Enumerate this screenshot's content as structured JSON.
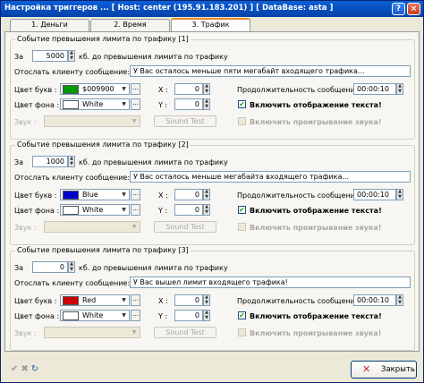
{
  "window": {
    "title": "Настройка триггеров ... [ Host: center (195.91.183.201) ] [ DataBase: asta ]",
    "help": "?",
    "close": "×"
  },
  "tabs": [
    {
      "label": "1. Деньги"
    },
    {
      "label": "2. Время"
    },
    {
      "label": "3. Трафик"
    }
  ],
  "labels": {
    "za": "За",
    "kb_suffix": "кб. до превышения лимита по трафику",
    "message": "Отослать клиенту сообщение:",
    "text_color": "Цвет букв :",
    "bg_color": "Цвет фона :",
    "sound": "Звук :",
    "x": "X :",
    "y": "Y :",
    "duration": "Продолжительность сообщения :",
    "sound_test": "Sound Test",
    "show_text": "Включить отображение текста!",
    "play_sound": "Включить проигрывание звука!",
    "dots": "…"
  },
  "groups": [
    {
      "legend": "Событие превышения лимита по трафику [1]",
      "kb": "5000",
      "message": "У Вас осталось меньше пяти мегабайт входящего трафика...",
      "text_color": {
        "name": "$009900",
        "hex": "#009900"
      },
      "bg_color": {
        "name": "White",
        "hex": "#ffffff"
      },
      "x": "0",
      "y": "0",
      "duration": "00:00:10",
      "show_text": true,
      "play_sound": false
    },
    {
      "legend": "Событие превышения лимита по трафику [2]",
      "kb": "1000",
      "message": "У Вас осталось меньше мегабайта входящего трафика...",
      "text_color": {
        "name": "Blue",
        "hex": "#0000cc"
      },
      "bg_color": {
        "name": "White",
        "hex": "#ffffff"
      },
      "x": "0",
      "y": "0",
      "duration": "00:00:10",
      "show_text": true,
      "play_sound": false
    },
    {
      "legend": "Событие превышения лимита по трафику [3]",
      "kb": "0",
      "message": "У Вас вышел лимит входящего трафика!",
      "text_color": {
        "name": "Red",
        "hex": "#cc0000"
      },
      "bg_color": {
        "name": "White",
        "hex": "#ffffff"
      },
      "x": "0",
      "y": "0",
      "duration": "00:00:10",
      "show_text": true,
      "play_sound": false
    }
  ],
  "footer": {
    "close_label": "Закрыть",
    "icons": [
      "check-icon",
      "cancel-icon",
      "refresh-icon"
    ]
  }
}
